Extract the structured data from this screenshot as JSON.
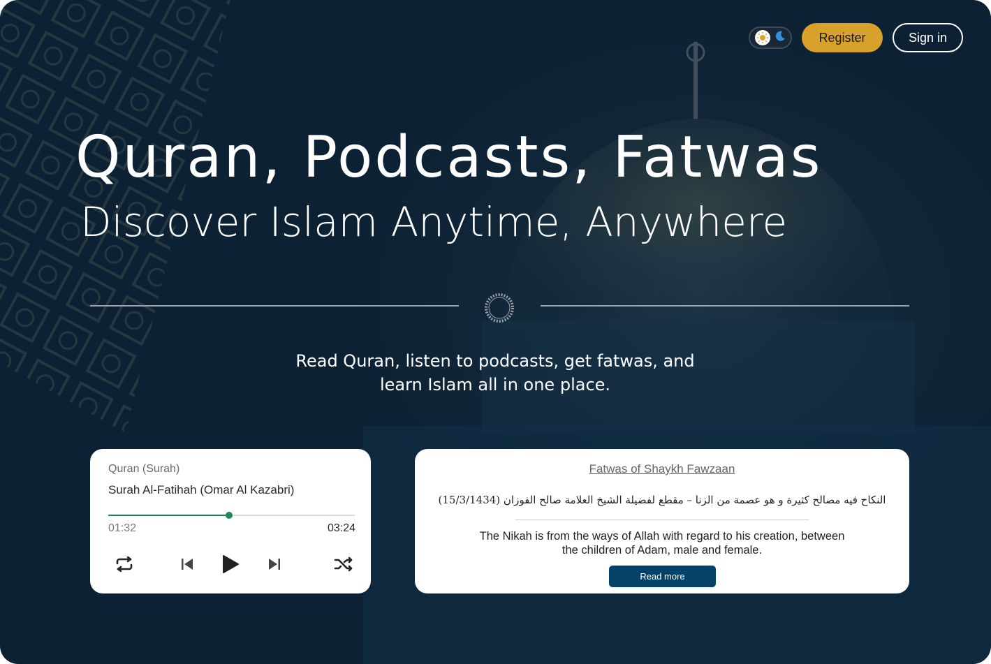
{
  "header": {
    "theme_toggle": {
      "light_icon": "sun-icon",
      "dark_icon": "moon-icon"
    },
    "register_label": "Register",
    "signin_label": "Sign in"
  },
  "hero": {
    "title": "Quran, Podcasts, Fatwas",
    "subtitle": "Discover Islam Anytime, Anywhere",
    "description": "Read Quran, listen to podcasts, get fatwas, and learn Islam all in one place."
  },
  "player": {
    "category": "Quran (Surah)",
    "track": "Surah Al-Fatihah (Omar Al Kazabri)",
    "current_time": "01:32",
    "total_time": "03:24",
    "progress": 0.49,
    "controls": [
      "repeat-icon",
      "previous-icon",
      "play-icon",
      "next-icon",
      "shuffle-icon"
    ]
  },
  "fatwa": {
    "source": "Fatwas of Shaykh Fawzaan",
    "arabic_title": "النكاح فيه مصالح كثيرة و هو عصمة من الزنا – مقطع لفضيلة الشيخ العلامة صالح الفوزان (15/3/1434)",
    "excerpt": "The Nikah is from the ways of Allah with regard to his creation, between the children of Adam, male and female.",
    "read_more_label": "Read more"
  },
  "colors": {
    "background": "#0c2133",
    "accent": "#d8a12c",
    "progress": "#1b8a5a",
    "button_primary": "#064268"
  }
}
